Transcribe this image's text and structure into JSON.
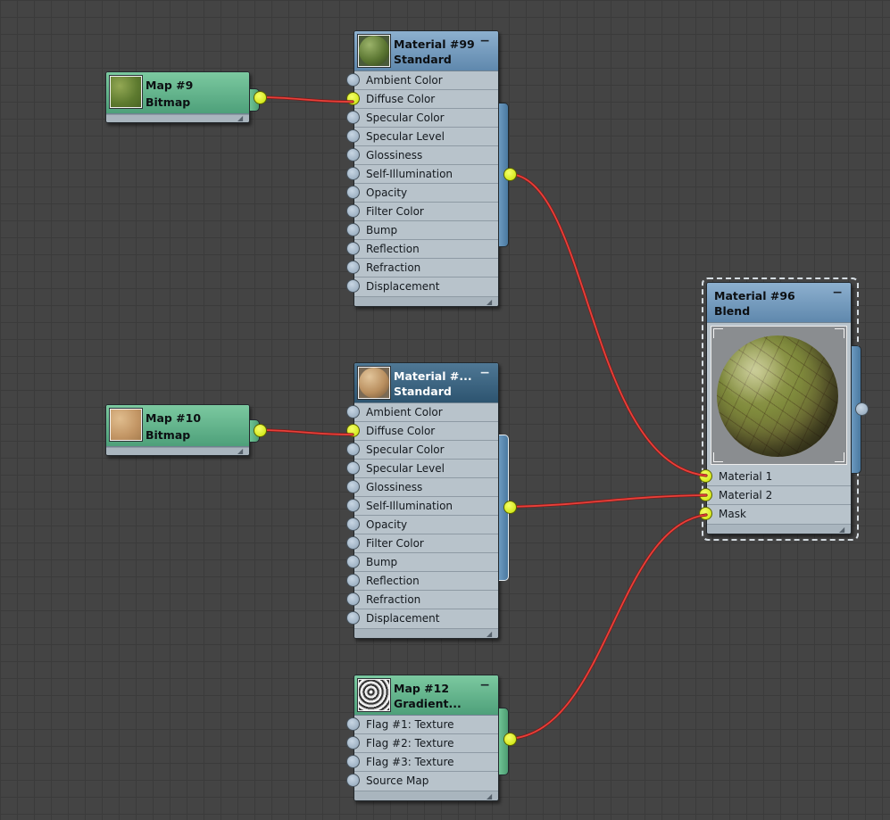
{
  "colors": {
    "wire": "#e8403a",
    "active_socket": "#d8ef00",
    "background": "#444444"
  },
  "nodes": {
    "map9": {
      "title": "Map #9",
      "subtitle": "Bitmap",
      "thumb_icon": "grass-bitmap-thumbnail",
      "thumb_color": "#6c8a3a"
    },
    "map10": {
      "title": "Map #10",
      "subtitle": "Bitmap",
      "thumb_icon": "sand-bitmap-thumbnail",
      "thumb_color": "#c9a072"
    },
    "mat99": {
      "title": "Material #99",
      "subtitle": "Standard",
      "minimize": "−",
      "slots": [
        "Ambient Color",
        "Diffuse Color",
        "Specular Color",
        "Specular Level",
        "Glossiness",
        "Self-Illumination",
        "Opacity",
        "Filter Color",
        "Bump",
        "Reflection",
        "Refraction",
        "Displacement"
      ]
    },
    "mat2": {
      "title": "Material #...",
      "subtitle": "Standard",
      "minimize": "−",
      "slots": [
        "Ambient Color",
        "Diffuse Color",
        "Specular Color",
        "Specular Level",
        "Glossiness",
        "Self-Illumination",
        "Opacity",
        "Filter Color",
        "Bump",
        "Reflection",
        "Refraction",
        "Displacement"
      ]
    },
    "map12": {
      "title": "Map #12",
      "subtitle": "Gradient...",
      "minimize": "−",
      "slots": [
        "Flag #1: Texture",
        "Flag #2: Texture",
        "Flag #3: Texture",
        "Source Map"
      ]
    },
    "mat96": {
      "title": "Material #96",
      "subtitle": "Blend",
      "minimize": "−",
      "slots": [
        "Material 1",
        "Material 2",
        "Mask"
      ]
    }
  }
}
